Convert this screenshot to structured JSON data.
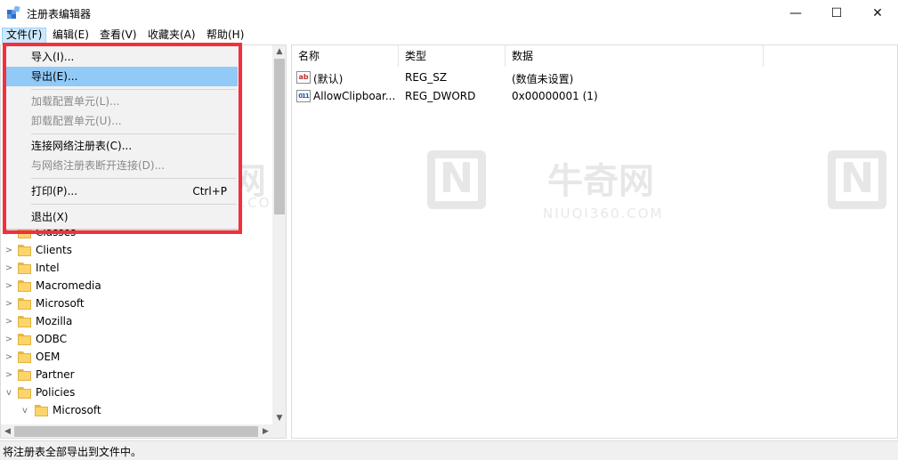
{
  "window": {
    "title": "注册表编辑器",
    "minimize_glyph": "—",
    "maximize_glyph": "☐",
    "close_glyph": "✕"
  },
  "menubar": {
    "items": [
      {
        "label": "文件(F)",
        "active": true
      },
      {
        "label": "编辑(E)"
      },
      {
        "label": "查看(V)"
      },
      {
        "label": "收藏夹(A)"
      },
      {
        "label": "帮助(H)"
      }
    ]
  },
  "file_menu": {
    "items": [
      {
        "label": "导入(I)...",
        "enabled": true
      },
      {
        "label": "导出(E)...",
        "enabled": true,
        "hovered": true
      },
      {
        "label": "加载配置单元(L)...",
        "enabled": false
      },
      {
        "label": "卸载配置单元(U)...",
        "enabled": false
      },
      {
        "label": "连接网络注册表(C)...",
        "enabled": true
      },
      {
        "label": "与网络注册表断开连接(D)...",
        "enabled": false
      },
      {
        "label": "打印(P)...",
        "accelerator": "Ctrl+P",
        "enabled": true
      },
      {
        "label": "退出(X)",
        "enabled": true
      }
    ],
    "highlight_color": "#f2303b"
  },
  "tree": {
    "items": [
      {
        "label": "Classes",
        "expander": "closed",
        "level": 0
      },
      {
        "label": "Clients",
        "expander": "closed",
        "level": 0
      },
      {
        "label": "Intel",
        "expander": "closed",
        "level": 0
      },
      {
        "label": "Macromedia",
        "expander": "closed",
        "level": 0
      },
      {
        "label": "Microsoft",
        "expander": "closed",
        "level": 0
      },
      {
        "label": "Mozilla",
        "expander": "closed",
        "level": 0
      },
      {
        "label": "ODBC",
        "expander": "closed",
        "level": 0
      },
      {
        "label": "OEM",
        "expander": "closed",
        "level": 0
      },
      {
        "label": "Partner",
        "expander": "closed",
        "level": 0
      },
      {
        "label": "Policies",
        "expander": "open",
        "level": 0
      },
      {
        "label": "Microsoft",
        "expander": "open",
        "level": 1
      }
    ]
  },
  "list": {
    "columns": [
      "名称",
      "类型",
      "数据"
    ],
    "rows": [
      {
        "icon": "string-value-icon",
        "name": "(默认)",
        "type": "REG_SZ",
        "data": "(数值未设置)"
      },
      {
        "icon": "dword-value-icon",
        "name": "AllowClipboar...",
        "type": "REG_DWORD",
        "data": "0x00000001 (1)"
      }
    ]
  },
  "watermark": {
    "logo_letter": "N",
    "brand": "牛奇网",
    "domain": "NIUQI360.COM"
  },
  "status": {
    "text": "将注册表全部导出到文件中。"
  }
}
